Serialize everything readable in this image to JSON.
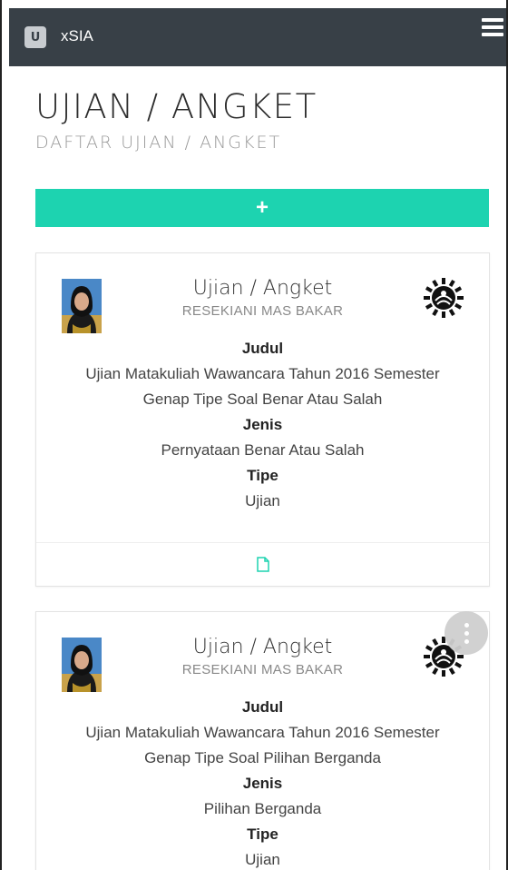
{
  "navbar": {
    "brand": "xSIA",
    "logo_letter": "U",
    "menu_icon": "hamburger-icon"
  },
  "header": {
    "title": "UJIAN / ANGKET",
    "subtitle": "DAFTAR UJIAN / ANGKET"
  },
  "add_button": {
    "label": "+",
    "color": "#1dd3b0"
  },
  "cards": [
    {
      "title": "Ujian / Angket",
      "owner": "RESEKIANI MAS BAKAR",
      "judul_label": "Judul",
      "judul": "Ujian Matakuliah Wawancara Tahun 2016 Semester Genap Tipe Soal Benar Atau Salah",
      "jenis_label": "Jenis",
      "jenis": "Pernyataan Benar Atau Salah",
      "tipe_label": "Tipe",
      "tipe": "Ujian",
      "footer_icon": "document-icon"
    },
    {
      "title": "Ujian / Angket",
      "owner": "RESEKIANI MAS BAKAR",
      "judul_label": "Judul",
      "judul": "Ujian Matakuliah Wawancara Tahun 2016 Semester Genap Tipe Soal Pilihan Berganda",
      "jenis_label": "Jenis",
      "jenis": "Pilihan Berganda",
      "tipe_label": "Tipe",
      "tipe": "Ujian"
    }
  ],
  "fab_icon": "more-vertical-icon",
  "colors": {
    "navbar": "#384047",
    "accent": "#1dd3b0"
  }
}
